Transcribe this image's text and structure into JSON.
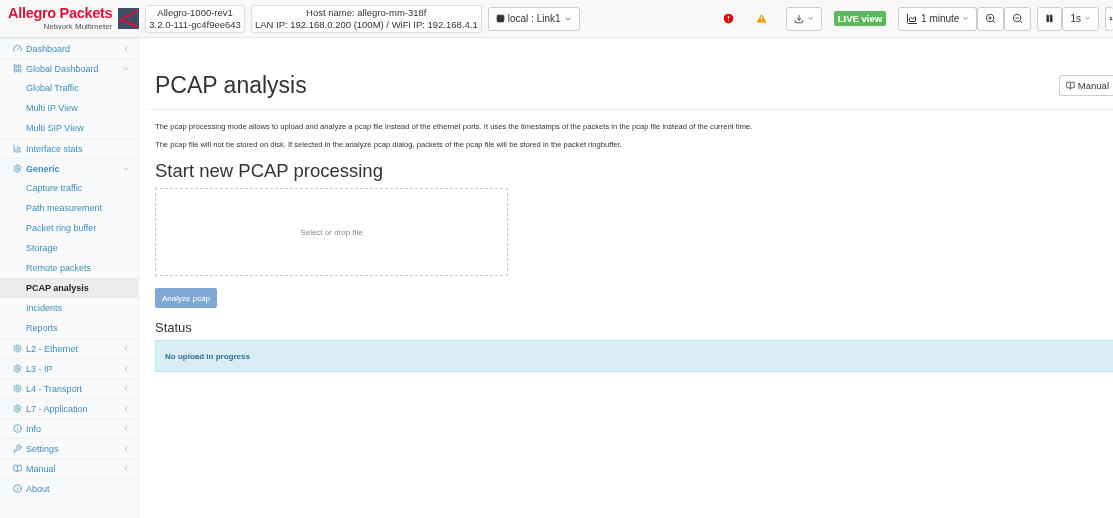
{
  "header": {
    "brand": "Allegro Packets",
    "tagline": "Network Multimeter",
    "device": {
      "name": "Allegro-1000-rev1",
      "version": "3.2.0-111-gc4f9ee643"
    },
    "host": {
      "name": "Host name: allegro-mm-318f",
      "ips": "LAN IP: 192.168.0.200 (100M) / WiFi IP: 192.168.4.1"
    },
    "link_selector": "local : Link1",
    "live_badge": "LIVE view",
    "interval": "1 minute",
    "refresh": "1s"
  },
  "sidebar": {
    "items": [
      {
        "kind": "section",
        "label": "Dashboard",
        "expanded": false,
        "selected": false
      },
      {
        "kind": "section",
        "label": "Global Dashboard",
        "expanded": true,
        "selected": false,
        "children": [
          {
            "label": "Global Traffic",
            "selected": false
          },
          {
            "label": "Multi IP View",
            "selected": false
          },
          {
            "label": "Multi SIP View",
            "selected": false
          }
        ]
      },
      {
        "kind": "link",
        "label": "Interface stats",
        "selected": false
      },
      {
        "kind": "section",
        "label": "Generic",
        "expanded": true,
        "selected": true,
        "children": [
          {
            "label": "Capture traffic",
            "selected": false
          },
          {
            "label": "Path measurement",
            "selected": false
          },
          {
            "label": "Packet ring buffer",
            "selected": false
          },
          {
            "label": "Storage",
            "selected": false
          },
          {
            "label": "Remote packets",
            "selected": false
          },
          {
            "label": "PCAP analysis",
            "selected": true
          },
          {
            "label": "Incidents",
            "selected": false
          },
          {
            "label": "Reports",
            "selected": false
          }
        ]
      },
      {
        "kind": "section",
        "label": "L2 - Ethernet",
        "expanded": false,
        "selected": false
      },
      {
        "kind": "section",
        "label": "L3 - IP",
        "expanded": false,
        "selected": false
      },
      {
        "kind": "section",
        "label": "L4 - Transport",
        "expanded": false,
        "selected": false
      },
      {
        "kind": "section",
        "label": "L7 - Application",
        "expanded": false,
        "selected": false
      },
      {
        "kind": "section",
        "label": "Info",
        "expanded": false,
        "selected": false
      },
      {
        "kind": "section",
        "label": "Settings",
        "expanded": false,
        "selected": false
      },
      {
        "kind": "section",
        "label": "Manual",
        "expanded": false,
        "selected": false
      },
      {
        "kind": "link",
        "label": "About",
        "selected": false
      }
    ]
  },
  "page": {
    "title": "PCAP analysis",
    "manual_button": "Manual",
    "intro": [
      "The pcap processing mode allows to upload and analyze a pcap file instead of the ethernet ports. It uses the timestamps of the packets in the pcap file instead of the current time.",
      "The pcap file will not be stored on disk. If selected in the analyze pcap dialog, packets of the pcap file will be stored in the packet ringbuffer."
    ],
    "section_title": "Start new PCAP processing",
    "dropzone": "Select or drop file",
    "analyze_button": {
      "label": "Analyze pcap",
      "disabled": true
    },
    "status_title": "Status",
    "status_message": "No upload in progress"
  }
}
